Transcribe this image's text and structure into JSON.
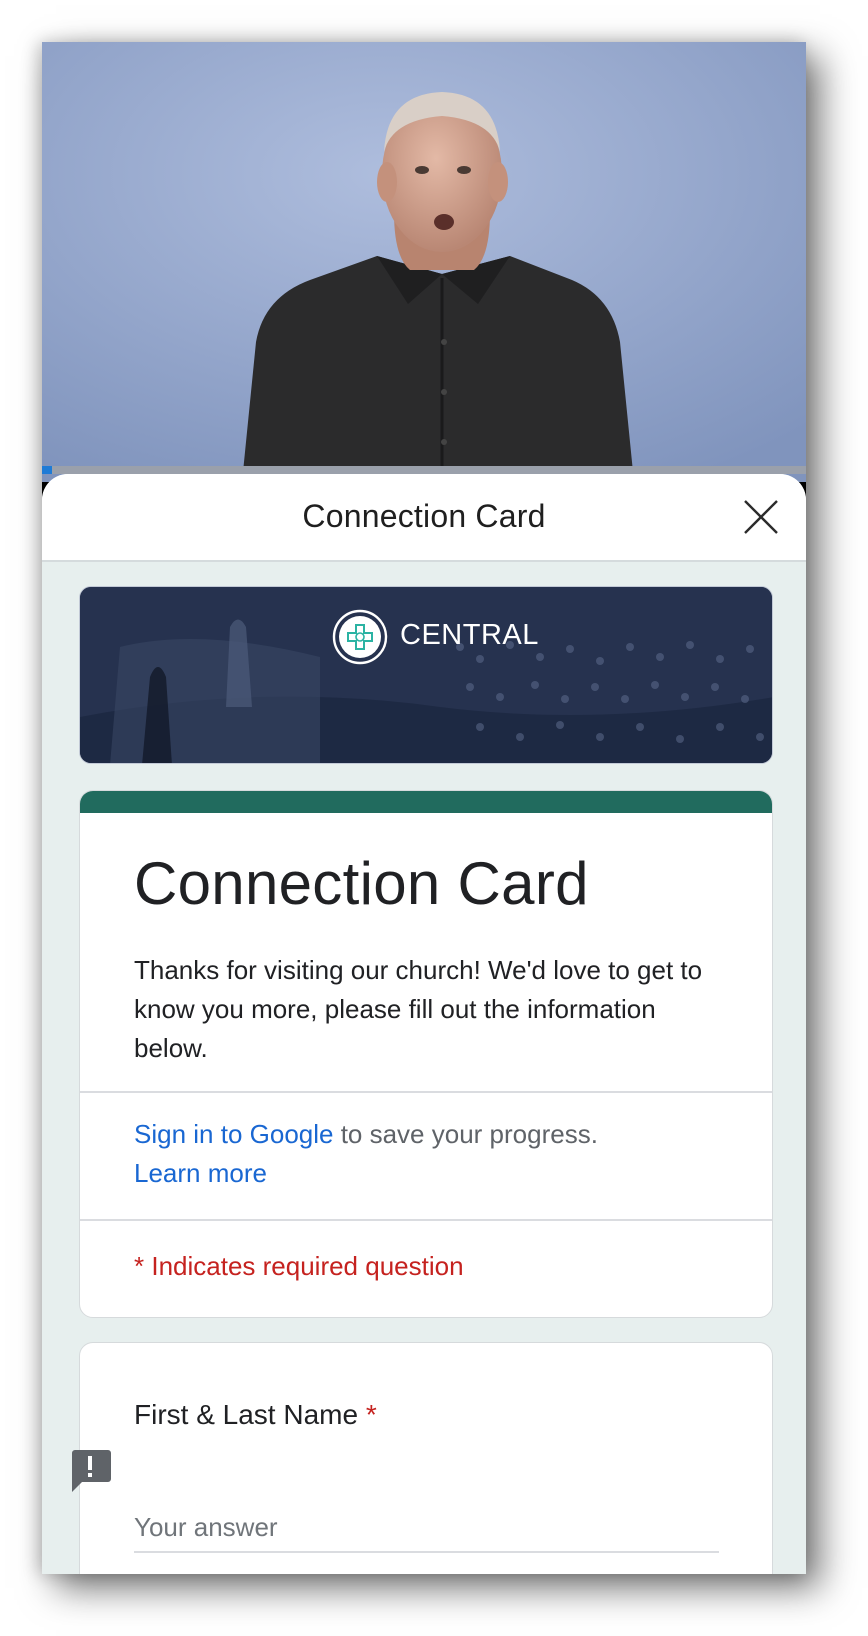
{
  "video": {
    "progress": 0.013,
    "progress_color": "#1f7bd6"
  },
  "sheet": {
    "title": "Connection Card",
    "close_icon": "close-icon"
  },
  "banner": {
    "logo_icon": "church-logo-icon",
    "text": "CENTRAL"
  },
  "form": {
    "accent_color": "#216b5e",
    "title": "Connection Card",
    "description": "Thanks for visiting our church! We'd love to get to know you more, please fill out the information below.",
    "signin_link": "Sign in to Google",
    "signin_rest": " to save your progress.",
    "learn_more": "Learn more",
    "required_note": "* Indicates required question"
  },
  "question": {
    "label": "First & Last Name",
    "required_mark": "*",
    "placeholder": "Your answer"
  },
  "feedback_icon": "feedback-icon"
}
